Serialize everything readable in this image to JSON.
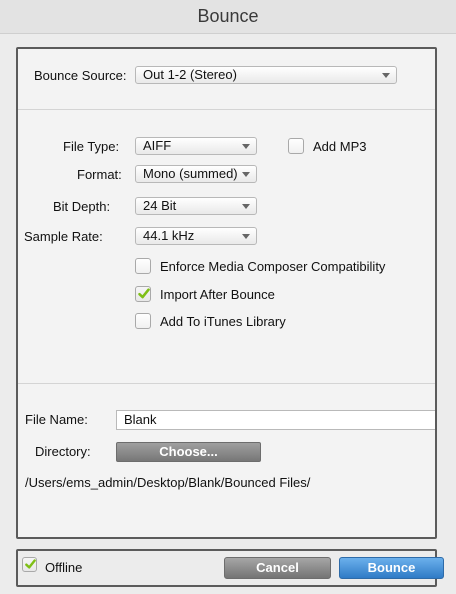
{
  "window": {
    "title": "Bounce"
  },
  "bounce_source": {
    "label": "Bounce Source:",
    "value": "Out 1-2 (Stereo)"
  },
  "file_type": {
    "label": "File Type:",
    "value": "AIFF"
  },
  "add_mp3": {
    "label": "Add MP3",
    "checked": false
  },
  "format": {
    "label": "Format:",
    "value": "Mono (summed)"
  },
  "bit_depth": {
    "label": "Bit Depth:",
    "value": "24 Bit"
  },
  "sample_rate": {
    "label": "Sample Rate:",
    "value": "44.1 kHz"
  },
  "options": [
    {
      "label": "Enforce Media Composer Compatibility",
      "checked": false
    },
    {
      "label": "Import After Bounce",
      "checked": true
    },
    {
      "label": "Add To iTunes Library",
      "checked": false
    }
  ],
  "file_name": {
    "label": "File Name:",
    "value": "Blank"
  },
  "directory": {
    "label": "Directory:",
    "button_label": "Choose...",
    "path": "/Users/ems_admin/Desktop/Blank/Bounced Files/"
  },
  "footer": {
    "offline_label": "Offline",
    "offline_checked": true,
    "cancel_label": "Cancel",
    "bounce_label": "Bounce"
  },
  "colors": {
    "checkmark": "#7fbf16",
    "primary_button": "#2f7bc6"
  }
}
